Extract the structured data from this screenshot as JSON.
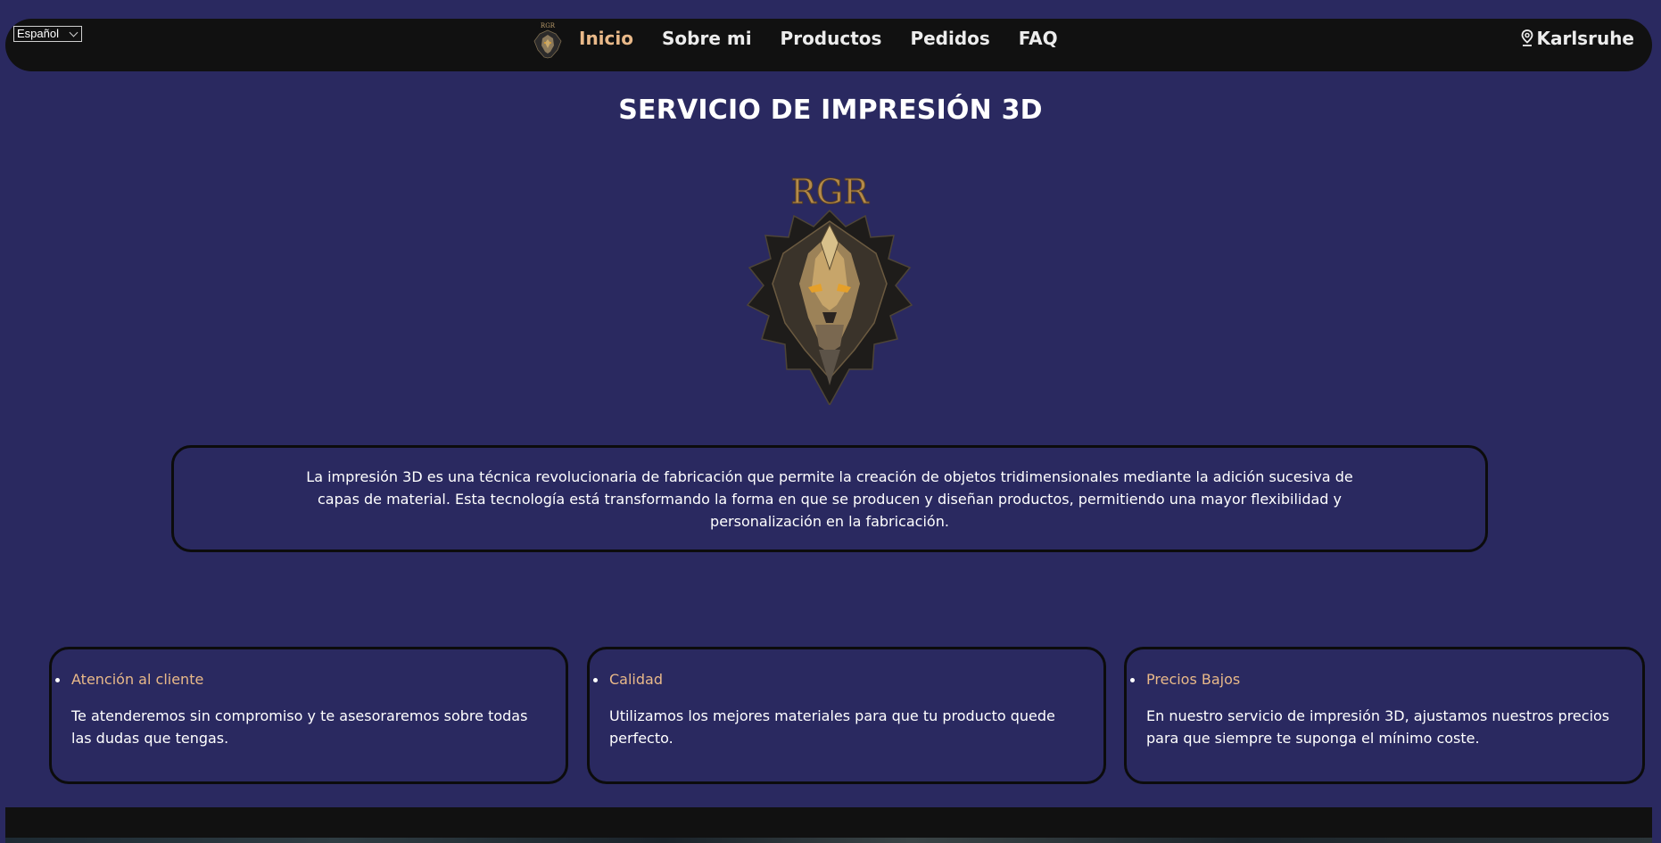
{
  "language_select": {
    "value": "Español"
  },
  "nav": {
    "items": [
      {
        "label": "Inicio",
        "active": true
      },
      {
        "label": "Sobre mi"
      },
      {
        "label": "Productos"
      },
      {
        "label": "Pedidos"
      },
      {
        "label": "FAQ"
      }
    ],
    "location": "Karlsruhe",
    "logo_text": "RGR"
  },
  "title": "SERVICIO DE IMPRESIÓN 3D",
  "hero_logo_text": "RGR",
  "intro": "La impresión 3D es una técnica revolucionaria de fabricación que permite la creación de objetos tridimensionales mediante la adición sucesiva de capas de material. Esta tecnología está transformando la forma en que se producen y diseñan productos, permitiendo una mayor flexibilidad y personalización en la fabricación.",
  "features": [
    {
      "heading": "Atención al cliente",
      "text": "Te atenderemos sin compromiso y te asesoraremos sobre todas las dudas que tengas."
    },
    {
      "heading": "Calidad",
      "text": "Utilizamos los mejores materiales para que tu producto quede perfecto."
    },
    {
      "heading": "Precios Bajos",
      "text": "En nuestro servicio de impresión 3D, ajustamos nuestros precios para que siempre te suponga el mínimo coste."
    }
  ],
  "colors": {
    "background": "#2a2960",
    "navbar": "#111111",
    "accent": "#e9b989",
    "border": "#0c0c0c"
  }
}
